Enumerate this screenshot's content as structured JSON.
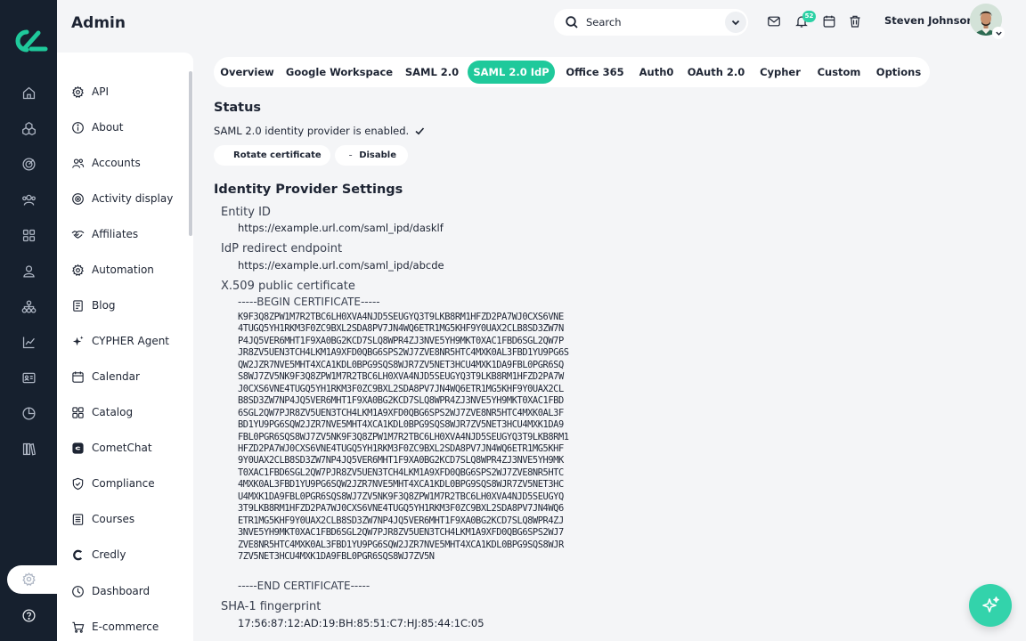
{
  "app": {
    "title": "Admin"
  },
  "colors": {
    "brand": "#1fc99b",
    "rail": "#16202e",
    "badge": "#2bd1a5"
  },
  "rail_icons": [
    "home-icon",
    "components-icon",
    "target-icon",
    "users-icon",
    "apps-icon",
    "profile-icon",
    "sitemap-icon",
    "chart-icon",
    "id-card-icon",
    "pie-icon",
    "library-icon",
    "settings-icon",
    "help-icon"
  ],
  "sidebar": {
    "items": [
      {
        "label": "API",
        "icon": "gear-icon"
      },
      {
        "label": "About",
        "icon": "info-icon"
      },
      {
        "label": "Accounts",
        "icon": "users-icon"
      },
      {
        "label": "Activity display",
        "icon": "target-icon"
      },
      {
        "label": "Affiliates",
        "icon": "handshake-icon"
      },
      {
        "label": "Automation",
        "icon": "gear-icon"
      },
      {
        "label": "Blog",
        "icon": "document-icon"
      },
      {
        "label": "CYPHER Agent",
        "icon": "sparkle-icon"
      },
      {
        "label": "Calendar",
        "icon": "calendar-icon"
      },
      {
        "label": "Catalog",
        "icon": "grid-icon"
      },
      {
        "label": "CometChat",
        "icon": "chat-icon"
      },
      {
        "label": "Compliance",
        "icon": "shield-icon"
      },
      {
        "label": "Courses",
        "icon": "list-icon"
      },
      {
        "label": "Credly",
        "icon": "credly-icon"
      },
      {
        "label": "Dashboard",
        "icon": "dashboard-icon"
      },
      {
        "label": "E-commerce",
        "icon": "cart-icon"
      }
    ]
  },
  "header": {
    "search_placeholder": "Search",
    "notifications_count": "52",
    "user_name": "Steven Johnson"
  },
  "tabs": [
    {
      "label": "Overview",
      "active": false
    },
    {
      "label": "Google Workspace",
      "active": false
    },
    {
      "label": "SAML 2.0",
      "active": false
    },
    {
      "label": "SAML 2.0 IdP",
      "active": true
    },
    {
      "label": "Office 365",
      "active": false
    },
    {
      "label": "Auth0",
      "active": false
    },
    {
      "label": "OAuth 2.0",
      "active": false
    },
    {
      "label": "Cypher",
      "active": false
    },
    {
      "label": "Custom",
      "active": false
    },
    {
      "label": "Options",
      "active": false
    }
  ],
  "status": {
    "heading": "Status",
    "text": "SAML 2.0 identity provider is enabled.",
    "rotate_label": "Rotate certificate",
    "disable_label": "Disable"
  },
  "idp": {
    "heading": "Identity Provider Settings",
    "entity_id_label": "Entity ID",
    "entity_id_value": "https://example.url.com/saml_ipd/dasklf",
    "redirect_label": "IdP redirect endpoint",
    "redirect_value": "https://example.url.com/saml_ipd/abcde",
    "cert_label": "X.509 public certificate",
    "cert_begin": "-----BEGIN CERTIFICATE-----",
    "cert_lines": [
      "K9F3Q8ZPW1M7R2TBC6LH0XVA4NJD5SEUGYQ3T9LKB8RM1HFZD2PA7WJ0CXS6VNE",
      "4TUGQ5YH1RKM3F0ZC9BXL2SDA8PV7JN4WQ6ETR1MG5KHF9Y0UAX2CLB8SD3ZW7N",
      "P4JQ5VER6MHT1F9XA0BG2KCD7SLQ8WPR4ZJ3NVE5YH9MKT0XAC1FBD6SGL2QW7P",
      "JR8ZV5UEN3TCH4LKM1A9XFD0QBG6SPS2WJ7ZVE8NR5HTC4MXK0AL3FBD1YU9PG6S",
      "QW2JZR7NVE5MHT4XCA1KDL0BPG9SQS8WJR7ZV5NET3HCU4MXK1DA9FBL0PGR6SQ",
      "S8WJ7ZV5NK9F3Q8ZPW1M7R2TBC6LH0XVA4NJD5SEUGYQ3T9LKB8RM1HFZD2PA7W",
      "J0CXS6VNE4TUGQ5YH1RKM3F0ZC9BXL2SDA8PV7JN4WQ6ETR1MG5KHF9Y0UAX2CL",
      "B8SD3ZW7NP4JQ5VER6MHT1F9XA0BG2KCD7SLQ8WPR4ZJ3NVE5YH9MKT0XAC1FBD",
      "6SGL2QW7PJR8ZV5UEN3TCH4LKM1A9XFD0QBG6SPS2WJ7ZVE8NR5HTC4MXK0AL3F",
      "BD1YU9PG6SQW2JZR7NVE5MHT4XCA1KDL0BPG9SQS8WJR7ZV5NET3HCU4MXK1DA9",
      "FBL0PGR6SQS8WJ7ZV5NK9F3Q8ZPW1M7R2TBC6LH0XVA4NJD5SEUGYQ3T9LKB8RM1",
      "HFZD2PA7WJ0CXS6VNE4TUGQ5YH1RKM3F0ZC9BXL2SDA8PV7JN4WQ6ETR1MG5KHF",
      "9Y0UAX2CLB8SD3ZW7NP4JQ5VER6MHT1F9XA0BG2KCD7SLQ8WPR4ZJ3NVE5YH9MK",
      "T0XAC1FBD6SGL2QW7PJR8ZV5UEN3TCH4LKM1A9XFD0QBG6SPS2WJ7ZVE8NR5HTC",
      "4MXK0AL3FBD1YU9PG6SQW2JZR7NVE5MHT4XCA1KDL0BPG9SQS8WJR7ZV5NET3HC",
      "U4MXK1DA9FBL0PGR6SQS8WJ7ZV5NK9F3Q8ZPW1M7R2TBC6LH0XVA4NJD5SEUGYQ",
      "3T9LKB8RM1HFZD2PA7WJ0CXS6VNE4TUGQ5YH1RKM3F0ZC9BXL2SDA8PV7JN4WQ6",
      "ETR1MG5KHF9Y0UAX2CLB8SD3ZW7NP4JQ5VER6MHT1F9XA0BG2KCD7SLQ8WPR4ZJ",
      "3NVE5YH9MKT0XAC1FBD6SGL2QW7PJR8ZV5UEN3TCH4LKM1A9XFD0QBG6SPS2WJ7",
      "ZVE8NR5HTC4MXK0AL3FBD1YU9PG6SQW2JZR7NVE5MHT4XCA1KDL0BPG9SQS8WJR",
      "7ZV5NET3HCU4MXK1DA9FBL0PGR6SQS8WJ7ZV5N"
    ],
    "cert_end": "-----END CERTIFICATE-----",
    "sha1_label": "SHA-1 fingerprint",
    "sha1_value": "17:56:87:12:AD:19:BH:85:51:C7:HJ:85:44:1C:05"
  }
}
